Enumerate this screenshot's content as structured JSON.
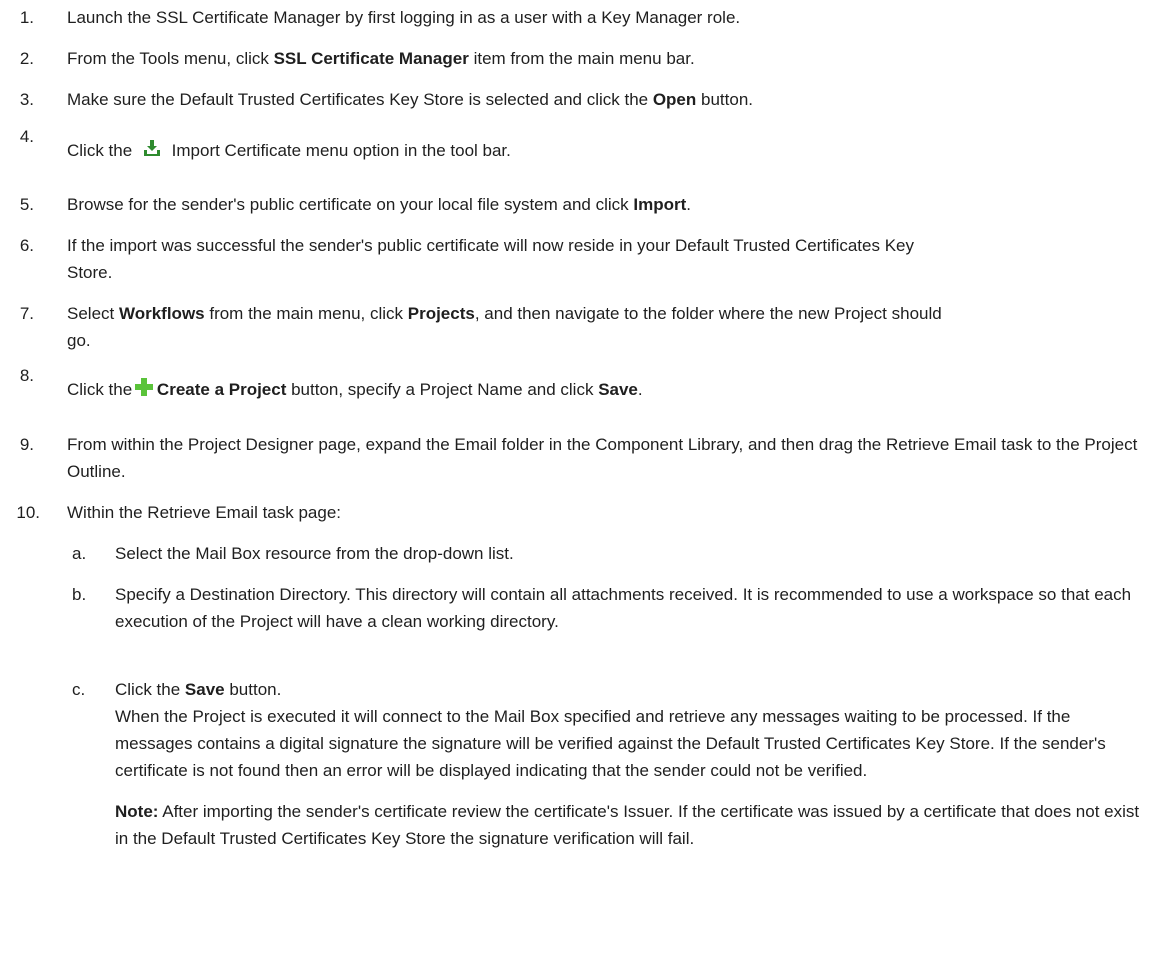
{
  "steps": [
    {
      "num": "1.",
      "text": "Launch the SSL Certificate Manager by first logging in as a user with a Key Manager role."
    },
    {
      "num": "2.",
      "pre": "From the Tools menu, click ",
      "bold": "SSL Certificate Manager",
      "post": " item from the main menu bar."
    },
    {
      "num": "3.",
      "pre": "Make sure the Default Trusted Certificates Key Store is selected and click the ",
      "bold": "Open",
      "post": " button."
    },
    {
      "num": "4.",
      "pre": "Click the ",
      "post": " Import Certificate menu option in the tool bar."
    },
    {
      "num": "5.",
      "pre": "Browse for the sender's public certificate on your local file system and click ",
      "bold": "Import",
      "post": "."
    },
    {
      "num": "6.",
      "text": "If the import was successful the sender's public certificate will now reside in your Default Trusted Certificates Key Store."
    },
    {
      "num": "7.",
      "pre": "Select ",
      "bold1": "Workflows",
      "mid": " from the main menu, click ",
      "bold2": "Projects",
      "post": ", and then navigate to the folder where the new Project should go."
    },
    {
      "num": "8.",
      "pre": "Click the ",
      "bold1": "Create a Project",
      "mid": " button, specify a Project Name and click ",
      "bold2": "Save",
      "post": "."
    },
    {
      "num": "9.",
      "text": "From within the Project Designer page, expand the Email folder in the Component Library, and then drag the Retrieve Email task to the Project Outline."
    },
    {
      "num": "10.",
      "text": "Within the Retrieve Email task page:"
    }
  ],
  "substeps": [
    {
      "num": "a.",
      "text": "Select the Mail Box resource from the drop-down list."
    },
    {
      "num": "b.",
      "text": "Specify a Destination Directory. This directory will contain all attachments received. It is recommended to use a workspace so that each execution of the Project will have a clean working directory."
    },
    {
      "num": "c.",
      "pre": "Click the ",
      "bold": "Save",
      "post": " button.",
      "para": "When the Project is executed it will connect to the Mail Box specified and retrieve any messages waiting to be processed. If the messages contains a digital signature the signature will be verified against the Default Trusted Certificates Key Store. If the sender's certificate is not found then an error will be displayed indicating that the sender could not be verified.",
      "note_label": "Note:",
      "note_text": " After importing the sender's certificate review the certificate's Issuer. If the certificate was issued by a certificate that does not exist in the Default Trusted Certificates Key Store the signature verification will fail."
    }
  ],
  "icons": {
    "import": "import-certificate-icon",
    "create": "create-project-icon"
  },
  "colors": {
    "import_icon": "#2e8b2e",
    "create_icon": "#5ac33a"
  }
}
